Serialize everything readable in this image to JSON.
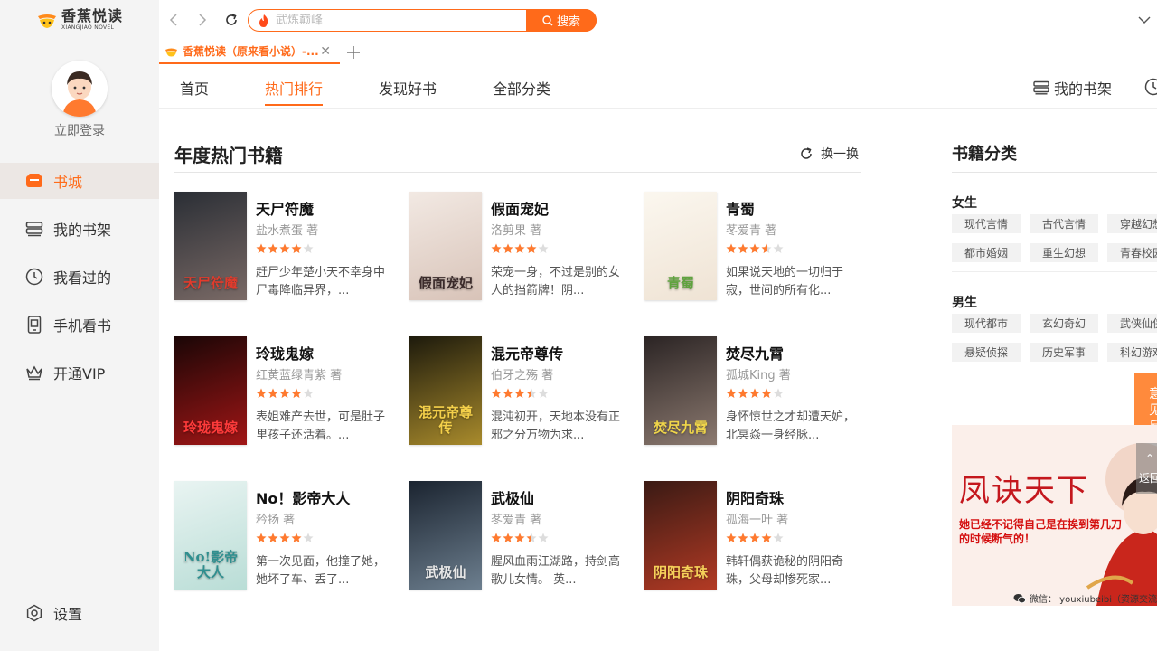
{
  "app": {
    "logo_cn": "香蕉悦读",
    "logo_en": "XIANGJIAO NOVEL"
  },
  "colors": {
    "accent": "#ff6a1a",
    "sidebar_bg": "#f4f4f4",
    "star_on": "#ff7a2f",
    "star_off": "#dddddd"
  },
  "sidebar": {
    "login": "立即登录",
    "items": [
      {
        "label": "书城",
        "icon": "book-city-icon"
      },
      {
        "label": "我的书架",
        "icon": "bookshelf-icon"
      },
      {
        "label": "我看过的",
        "icon": "clock-icon"
      },
      {
        "label": "手机看书",
        "icon": "phone-icon"
      },
      {
        "label": "开通VIP",
        "icon": "crown-icon"
      }
    ],
    "settings": "设置"
  },
  "search": {
    "placeholder": "武炼巅峰",
    "button": "搜索"
  },
  "tab": {
    "title": "香蕉悦读（原来看小说）-..."
  },
  "content_nav": {
    "items": [
      "首页",
      "热门排行",
      "发现好书",
      "全部分类"
    ],
    "active": 1,
    "bookshelf": "我的书架"
  },
  "section": {
    "title": "年度热门书籍",
    "refresh": "换一换"
  },
  "books": [
    {
      "title": "天尸符魔",
      "author": "盐水煮蛋 著",
      "rating": 4,
      "desc": "赶尸少年楚小天不幸身中尸毒降临异界，..."
    },
    {
      "title": "假面宠妃",
      "author": "洛剪果 著",
      "rating": 4,
      "desc": "荣宠一身，不过是别的女人的挡箭牌！阴..."
    },
    {
      "title": "青蜀",
      "author": "苳爱青 著",
      "rating": 3.5,
      "desc": "如果说天地的一切归于寂，世间的所有化..."
    },
    {
      "title": "玲珑鬼嫁",
      "author": "红黄蓝绿青紫 著",
      "rating": 4,
      "desc": "表姐难产去世，可是肚子里孩子还活着。..."
    },
    {
      "title": "混元帝尊传",
      "author": "伯牙之殇 著",
      "rating": 3.5,
      "desc": "混沌初开，天地本没有正邪之分万物为求..."
    },
    {
      "title": "焚尽九霄",
      "author": "孤城King 著",
      "rating": 4,
      "desc": "身怀惊世之才却遭天妒，北冥焱一身经脉..."
    },
    {
      "title": "No！影帝大人",
      "author": "矜扬 著",
      "rating": 4,
      "desc": "第一次见面，他撞了她，她坏了车、丢了..."
    },
    {
      "title": "武极仙",
      "author": "苳爱青 著",
      "rating": 3.5,
      "desc": "腥风血雨江湖路，持剑高歌儿女情。 英..."
    },
    {
      "title": "阴阳奇珠",
      "author": "孤海一叶 著",
      "rating": 4,
      "desc": "韩轩偶获诡秘的阴阳奇珠，父母却惨死家..."
    }
  ],
  "covers": [
    {
      "text": "天尸符魔",
      "bg1": "#2a2e35",
      "bg2": "#7a6a66",
      "color": "#e23b2c"
    },
    {
      "text": "假面宠妃",
      "bg1": "#f2e9e3",
      "bg2": "#d8c3b8",
      "color": "#3a2a2a"
    },
    {
      "text": "青蜀",
      "bg1": "#fbf7ef",
      "bg2": "#efe3d4",
      "color": "#5fa33e"
    },
    {
      "text": "玲珑鬼嫁",
      "bg1": "#1a0606",
      "bg2": "#a11616",
      "color": "#ff3b3b"
    },
    {
      "text": "混元帝尊传",
      "bg1": "#1d1a0c",
      "bg2": "#a98b2c",
      "color": "#f4d04a"
    },
    {
      "text": "焚尽九霄",
      "bg1": "#2b2424",
      "bg2": "#8c7a70",
      "color": "#f0d64a"
    },
    {
      "text": "No!影帝大人",
      "bg1": "#e9f4f2",
      "bg2": "#b9ddd6",
      "color": "#2f8f8f"
    },
    {
      "text": "武极仙",
      "bg1": "#1b2430",
      "bg2": "#6d7f8f",
      "color": "#e7e7e7"
    },
    {
      "text": "阴阳奇珠",
      "bg1": "#3a1a14",
      "bg2": "#b23a24",
      "color": "#f6d15a"
    }
  ],
  "categories": {
    "title": "书籍分类",
    "female": {
      "label": "女生",
      "tags": [
        "现代言情",
        "古代言情",
        "穿越幻想",
        "都市婚姻",
        "重生幻想",
        "青春校园"
      ]
    },
    "male": {
      "label": "男生",
      "tags": [
        "现代都市",
        "玄幻奇幻",
        "武侠仙侠",
        "悬疑侦探",
        "历史军事",
        "科幻游戏"
      ]
    }
  },
  "feedback": "意见反馈",
  "ad": {
    "title": "凤诀天下",
    "subtitle": "她已经不记得自己是在挨到第几刀的时候断气的！",
    "footer": "微信： youxiubeibi（资源交流",
    "back": "返回"
  }
}
